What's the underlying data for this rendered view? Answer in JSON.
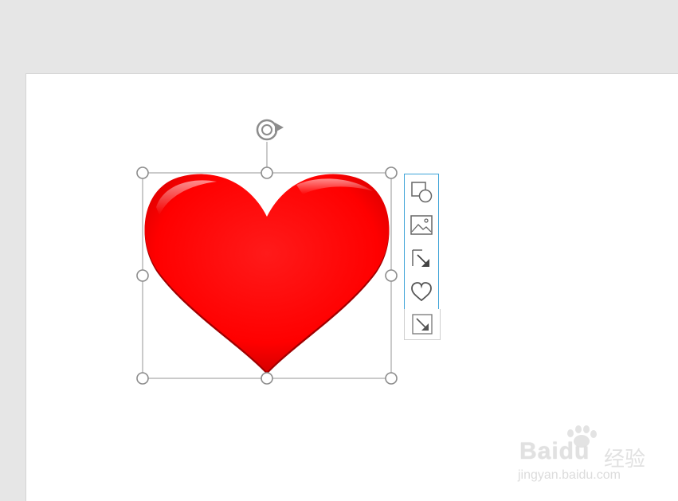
{
  "toolbar": {
    "buttons": [
      {
        "icon": "shapes-icon",
        "label": "Change shape"
      },
      {
        "icon": "picture-icon",
        "label": "Picture"
      },
      {
        "icon": "resize-corner-icon",
        "label": "Crop"
      },
      {
        "icon": "heart-outline-icon",
        "label": "Shape outline"
      },
      {
        "icon": "expand-corner-icon",
        "label": "More"
      }
    ]
  },
  "shape": {
    "type": "heart",
    "fill_color": "#ff0000",
    "selected": true
  },
  "colors": {
    "workspace": "#e6e6e6",
    "slide": "#ffffff",
    "selection": "#a6a6a6",
    "toolbar_accent": "#3ea3d8"
  },
  "watermark": {
    "logo": "Baidu",
    "cn": "经验",
    "url": "jingyan.baidu.com"
  }
}
